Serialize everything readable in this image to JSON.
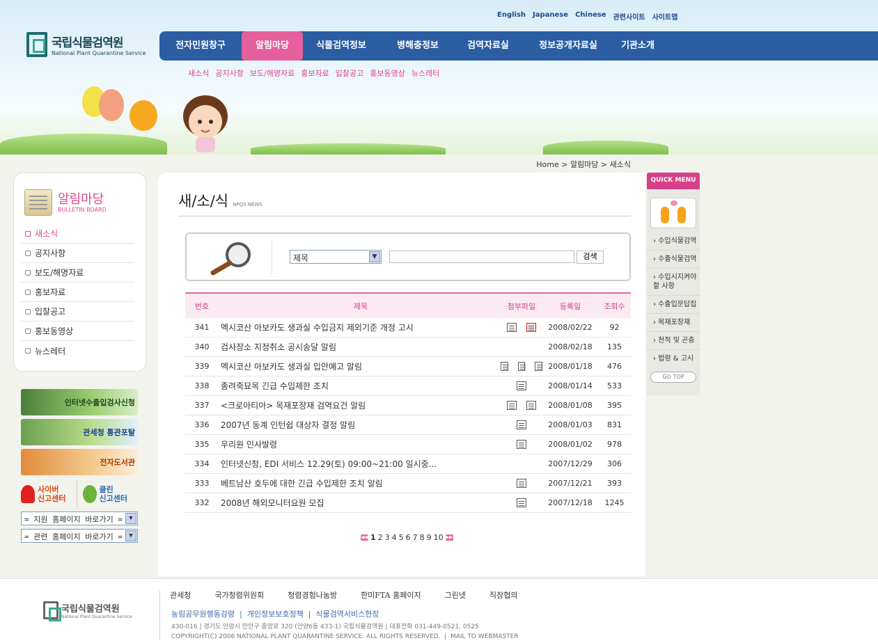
{
  "util_links": [
    "English",
    "Japanese",
    "Chinese",
    "관련사이트",
    "사이트맵"
  ],
  "logo": {
    "ko": "국립식물검역원",
    "en": "National Plant Quarantine Service"
  },
  "gnb": [
    {
      "label": "전자민원창구"
    },
    {
      "label": "알림마당",
      "active": true
    },
    {
      "label": "식물검역정보"
    },
    {
      "label": "병해충정보"
    },
    {
      "label": "검역자료실"
    },
    {
      "label": "정보공개자료실"
    },
    {
      "label": "기관소개"
    }
  ],
  "lnb": [
    "새소식",
    "공지사항",
    "보도/해명자료",
    "홍보자료",
    "입찰공고",
    "홍보동영상",
    "뉴스레터"
  ],
  "location": "Home > 알림마당 > 새소식",
  "side": {
    "title_ko": "알림마당",
    "title_en": "BULLETIN BOARD",
    "items": [
      "새소식",
      "공지사항",
      "보도/해명자료",
      "홍보자료",
      "입찰공고",
      "홍보동영상",
      "뉴스레터"
    ]
  },
  "banners": {
    "b1": "인터넷수출입검사신청",
    "b2": "관세청 통관포탈",
    "b3": "전자도서관"
  },
  "report": {
    "cyber": "사이버\n신고센터",
    "clean": "클린\n신고센터"
  },
  "selects": {
    "s1": "= 지원 홈페이지 바로가기 =",
    "s2": "= 관련 홈페이지 바로가기 ="
  },
  "page_title": {
    "ko": "새/소/식",
    "en": "NPQS NEWS"
  },
  "search": {
    "field": "제목",
    "button": "검색"
  },
  "board": {
    "headers": {
      "num": "번호",
      "subject": "제목",
      "file": "첨부파일",
      "date": "등록일",
      "count": "조회수"
    },
    "rows": [
      {
        "num": "341",
        "subject": "멕시코산 아보카도 생과실 수입금지 제외기준 개정 고시",
        "files": [
          "hwp",
          "pdf"
        ],
        "date": "2008/02/22",
        "count": "92"
      },
      {
        "num": "340",
        "subject": "검사장소 지정취소 공시송달 알림",
        "files": [],
        "date": "2008/02/18",
        "count": "135"
      },
      {
        "num": "339",
        "subject": "멕시코산 아보카도 생과실 입안예고 알림",
        "files": [
          "hwp",
          "hwp",
          "hwp"
        ],
        "date": "2008/01/18",
        "count": "476"
      },
      {
        "num": "338",
        "subject": "종려죽묘목 긴급 수입제한 조치",
        "files": [
          "hwp"
        ],
        "date": "2008/01/14",
        "count": "533"
      },
      {
        "num": "337",
        "subject": "<크로아티아> 목재포장재 검역요건 알림",
        "files": [
          "hwp",
          "hwp"
        ],
        "date": "2008/01/08",
        "count": "395"
      },
      {
        "num": "336",
        "subject": "2007년 동계 인턴쉽 대상자 결정 알림",
        "files": [
          "hwp"
        ],
        "date": "2008/01/03",
        "count": "831"
      },
      {
        "num": "335",
        "subject": "우리원 인사발령",
        "files": [
          "hwp"
        ],
        "date": "2008/01/02",
        "count": "978"
      },
      {
        "num": "334",
        "subject": "인터넷신청, EDI 서비스 12.29(토) 09:00~21:00 일시중...",
        "files": [],
        "date": "2007/12/29",
        "count": "306"
      },
      {
        "num": "333",
        "subject": "베트남산 호두에 대한 긴급 수입제한 조치 알림",
        "files": [
          "hwp"
        ],
        "date": "2007/12/21",
        "count": "393"
      },
      {
        "num": "332",
        "subject": "2008년 해외모니터요원 모집",
        "files": [
          "hwp"
        ],
        "date": "2007/12/18",
        "count": "1245"
      }
    ]
  },
  "paging": [
    "1",
    "2",
    "3",
    "4",
    "5",
    "6",
    "7",
    "8",
    "9",
    "10"
  ],
  "quick": {
    "title": "QUICK MENU",
    "items": [
      "› 수입식물검역",
      "› 수출식물검역",
      "› 수입시지켜야 할 사항",
      "› 수출입문답집",
      "› 목재포장재",
      "› 천적 및 곤충",
      "› 법령 & 고시"
    ],
    "top": "GO TOP"
  },
  "footer": {
    "logo_ko": "국립식물검역원",
    "logo_en": "National Plant Quarantine Service",
    "links": [
      "관세청",
      "국가청렴위원회",
      "청렴경험나눔방",
      "한미FTA 홈페이지",
      "그린넷",
      "직장협의"
    ],
    "policies": "농림공무원행동강령  |  개인정보보호정책  |  식물검역서비스헌장",
    "address": "430-016  |  경기도 안양시 만안구 중앙로 320 (안양6동 433-1) 국립식물검역원  |  대표전화 031-449-0521, 0525",
    "copyright": "COPYRIGHT(C) 2006 NATIONAL PLANT QUARANTINE SERVICE. ALL RIGHTS RESERVED.  |  MAIL TO WEBMASTER"
  }
}
